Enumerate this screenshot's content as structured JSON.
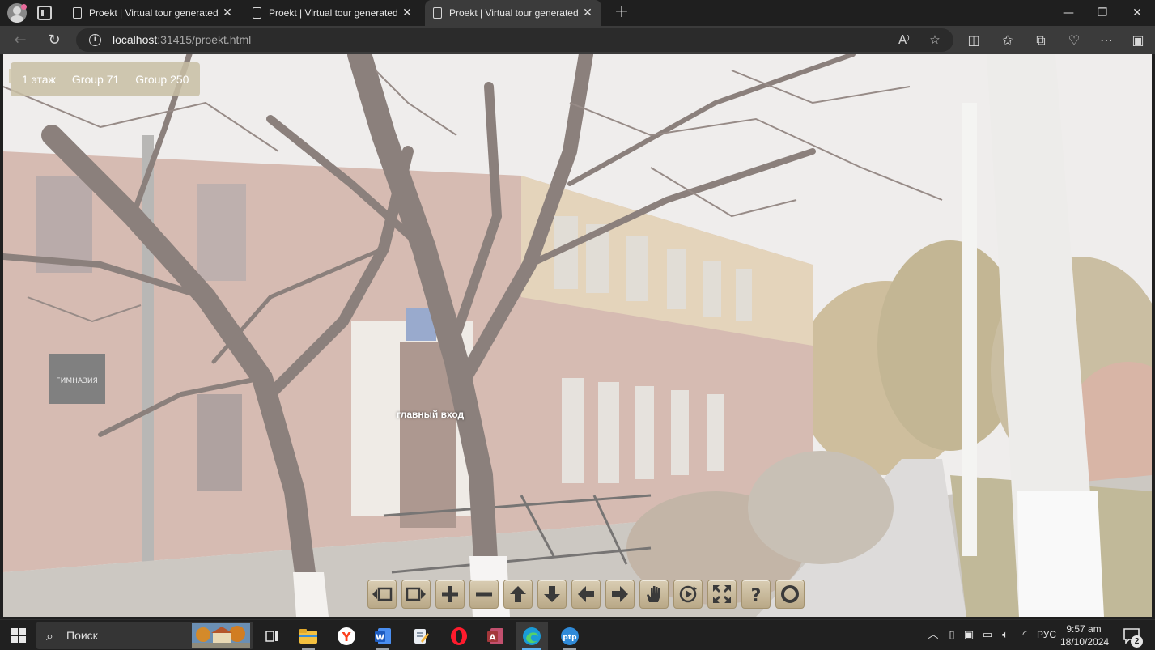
{
  "browser": {
    "tabs": [
      {
        "title": "Proekt | Virtual tour generated by Panotour",
        "close": "✕"
      },
      {
        "title": "Proekt | Virtual tour generated by Panotour",
        "close": "✕"
      },
      {
        "title": "Proekt | Virtual tour generated by Panotour",
        "close": "✕"
      }
    ],
    "active_tab_index": 2,
    "new_tab": "+",
    "window_buttons": {
      "minimize": "—",
      "maximize": "❐",
      "close": "✕"
    },
    "url_host": "localhost",
    "url_rest": ":31415/proekt.html"
  },
  "tour": {
    "floor_menu": [
      "1 этаж",
      "Group 71",
      "Group 250"
    ],
    "hotspot_label": "главный вход",
    "controls": [
      {
        "name": "prev-scene-button",
        "icon": "prev-scene"
      },
      {
        "name": "next-scene-button",
        "icon": "next-scene"
      },
      {
        "name": "zoom-in-button",
        "icon": "plus"
      },
      {
        "name": "zoom-out-button",
        "icon": "minus"
      },
      {
        "name": "move-up-button",
        "icon": "arrow-up"
      },
      {
        "name": "move-down-button",
        "icon": "arrow-down"
      },
      {
        "name": "move-left-button",
        "icon": "arrow-left"
      },
      {
        "name": "move-right-button",
        "icon": "arrow-right"
      },
      {
        "name": "drag-mode-button",
        "icon": "hand"
      },
      {
        "name": "autorotate-button",
        "icon": "autorotate"
      },
      {
        "name": "fullscreen-button",
        "icon": "fullscreen"
      },
      {
        "name": "help-button",
        "icon": "question"
      },
      {
        "name": "reset-view-button",
        "icon": "circle"
      }
    ],
    "building_sign": "ГИМНАЗИЯ"
  },
  "taskbar": {
    "search_placeholder": "Поиск",
    "language": "РУС",
    "time": "9:57 am",
    "date": "18/10/2024",
    "notification_count": "2"
  }
}
